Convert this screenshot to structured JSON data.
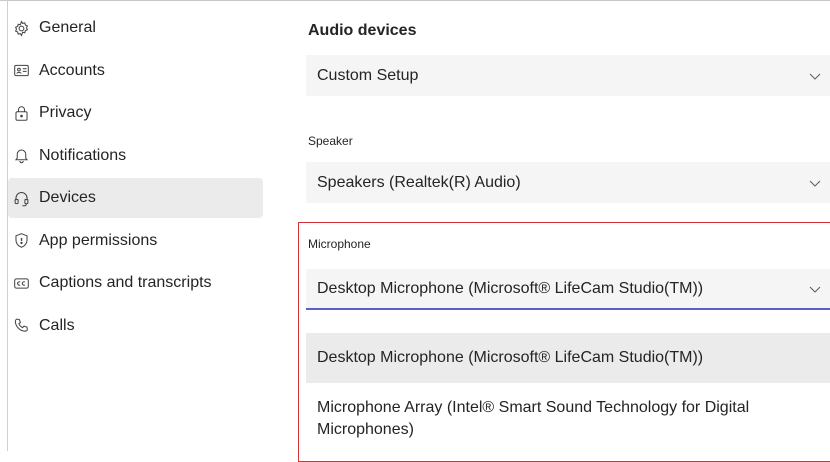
{
  "sidebar": {
    "items": [
      {
        "label": "General",
        "icon": "gear-icon",
        "active": false
      },
      {
        "label": "Accounts",
        "icon": "id-card-icon",
        "active": false
      },
      {
        "label": "Privacy",
        "icon": "lock-icon",
        "active": false
      },
      {
        "label": "Notifications",
        "icon": "bell-icon",
        "active": false
      },
      {
        "label": "Devices",
        "icon": "headset-icon",
        "active": true
      },
      {
        "label": "App permissions",
        "icon": "shield-icon",
        "active": false
      },
      {
        "label": "Captions and transcripts",
        "icon": "cc-icon",
        "active": false
      },
      {
        "label": "Calls",
        "icon": "phone-icon",
        "active": false
      }
    ]
  },
  "main": {
    "title": "Audio devices",
    "audio_setup": {
      "value": "Custom Setup"
    },
    "speaker": {
      "label": "Speaker",
      "value": "Speakers (Realtek(R) Audio)"
    },
    "microphone": {
      "label": "Microphone",
      "value": "Desktop Microphone (Microsoft® LifeCam Studio(TM))",
      "options": [
        {
          "label": "Desktop Microphone (Microsoft® LifeCam Studio(TM))",
          "selected": true
        },
        {
          "label": "Microphone Array (Intel® Smart Sound Technology for Digital Microphones)",
          "selected": false
        }
      ]
    }
  },
  "colors": {
    "highlight_border": "#d13438",
    "focus_underline": "#5b5fc7",
    "selected_bg": "#ebebeb",
    "dropdown_bg": "#f5f5f5"
  }
}
